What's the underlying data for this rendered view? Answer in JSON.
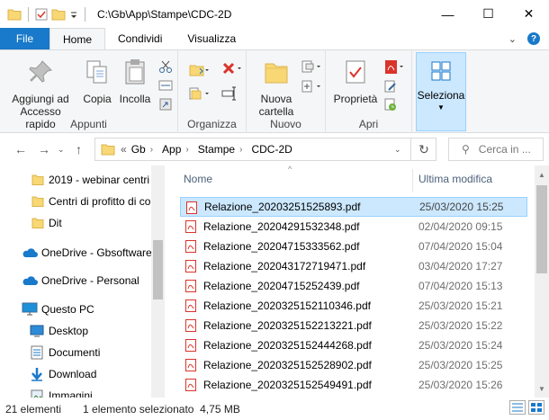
{
  "window": {
    "path": "C:\\Gb\\App\\Stampe\\CDC-2D",
    "minimize_glyph": "—",
    "maximize_glyph": "☐",
    "close_glyph": "✕"
  },
  "tabs": [
    {
      "label": "File"
    },
    {
      "label": "Home"
    },
    {
      "label": "Condividi"
    },
    {
      "label": "Visualizza"
    }
  ],
  "ribbon": {
    "appunti": {
      "label": "Appunti",
      "pin_label": "Aggiungi ad Accesso rapido",
      "copy_label": "Copia",
      "paste_label": "Incolla"
    },
    "organizza": {
      "label": "Organizza"
    },
    "nuovo": {
      "label": "Nuovo",
      "new_folder_label": "Nuova cartella"
    },
    "apri": {
      "label": "Apri",
      "properties_label": "Proprietà"
    },
    "seleziona": {
      "label": "Seleziona"
    }
  },
  "address": {
    "crumbs": [
      "Gb",
      "App",
      "Stampe",
      "CDC-2D"
    ],
    "overflow": "«",
    "search_placeholder": "Cerca in ..."
  },
  "navpane": {
    "items": [
      {
        "label": "2019 - webinar centri"
      },
      {
        "label": "Centri di profitto di co"
      },
      {
        "label": "Dit"
      },
      {
        "label": "OneDrive - Gbsoftware"
      },
      {
        "label": "OneDrive - Personal"
      },
      {
        "label": "Questo PC"
      },
      {
        "label": "Desktop"
      },
      {
        "label": "Documenti"
      },
      {
        "label": "Download"
      },
      {
        "label": "Immagini"
      }
    ]
  },
  "filelist": {
    "col_name": "Nome",
    "col_date": "Ultima modifica",
    "files": [
      {
        "name": "Relazione_20203251525893.pdf",
        "date": "25/03/2020 15:25",
        "selected": true
      },
      {
        "name": "Relazione_20204291532348.pdf",
        "date": "02/04/2020 09:15"
      },
      {
        "name": "Relazione_20204715333562.pdf",
        "date": "07/04/2020 15:04"
      },
      {
        "name": "Relazione_202043172719471.pdf",
        "date": "03/04/2020 17:27"
      },
      {
        "name": "Relazione_20204715252439.pdf",
        "date": "07/04/2020 15:13"
      },
      {
        "name": "Relazione_202032515211034​6.pdf",
        "date": "25/03/2020 15:21"
      },
      {
        "name": "Relazione_202032515221322​1.pdf",
        "date": "25/03/2020 15:22"
      },
      {
        "name": "Relazione_202032515244426​8.pdf",
        "date": "25/03/2020 15:24"
      },
      {
        "name": "Relazione_202032515252890​2.pdf",
        "date": "25/03/2020 15:25"
      },
      {
        "name": "Relazione_202032515254949​1.pdf",
        "date": "25/03/2020 15:26"
      }
    ]
  },
  "status": {
    "count": "21 elementi",
    "selection": "1 elemento selezionato  4,75 MB"
  },
  "colors": {
    "accent": "#1979ca",
    "selection": "#cce8ff",
    "pdf_red": "#d9342b",
    "folder": "#f8d775"
  }
}
